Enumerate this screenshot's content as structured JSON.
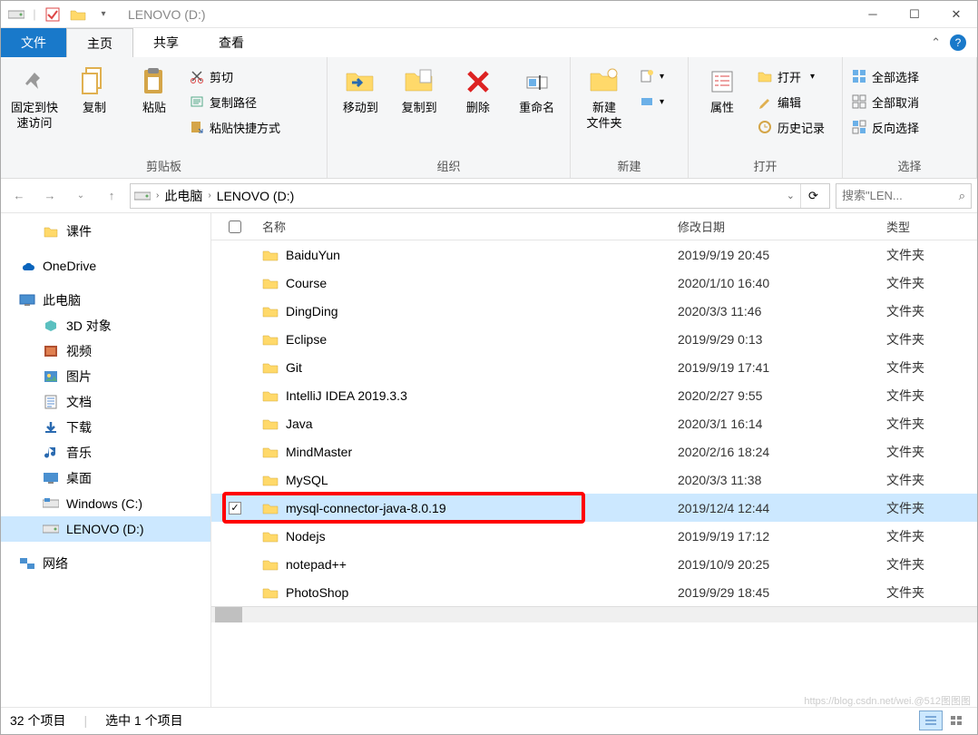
{
  "title": "LENOVO (D:)",
  "tabs": {
    "file": "文件",
    "home": "主页",
    "share": "共享",
    "view": "查看"
  },
  "ribbon": {
    "pin": "固定到快\n速访问",
    "copy": "复制",
    "paste": "粘贴",
    "cut": "剪切",
    "copypath": "复制路径",
    "pasteshortcut": "粘贴快捷方式",
    "group_clipboard": "剪贴板",
    "moveto": "移动到",
    "copyto": "复制到",
    "delete": "删除",
    "rename": "重命名",
    "group_organize": "组织",
    "newfolder": "新建\n文件夹",
    "group_new": "新建",
    "properties": "属性",
    "open": "打开",
    "edit": "编辑",
    "history": "历史记录",
    "group_open": "打开",
    "selectall": "全部选择",
    "selectnone": "全部取消",
    "selectinvert": "反向选择",
    "group_select": "选择"
  },
  "breadcrumb": {
    "pc": "此电脑",
    "drive": "LENOVO (D:)"
  },
  "search_placeholder": "搜索\"LEN...",
  "columns": {
    "name": "名称",
    "date": "修改日期",
    "type": "类型"
  },
  "sidebar": {
    "courseware": "课件",
    "onedrive": "OneDrive",
    "thispc": "此电脑",
    "3d": "3D 对象",
    "video": "视频",
    "pictures": "图片",
    "documents": "文档",
    "downloads": "下载",
    "music": "音乐",
    "desktop": "桌面",
    "cdrive": "Windows (C:)",
    "ddrive": "LENOVO (D:)",
    "network": "网络"
  },
  "files": [
    {
      "name": "BaiduYun",
      "date": "2019/9/19 20:45",
      "type": "文件夹",
      "selected": false
    },
    {
      "name": "Course",
      "date": "2020/1/10 16:40",
      "type": "文件夹",
      "selected": false
    },
    {
      "name": "DingDing",
      "date": "2020/3/3 11:46",
      "type": "文件夹",
      "selected": false
    },
    {
      "name": "Eclipse",
      "date": "2019/9/29 0:13",
      "type": "文件夹",
      "selected": false
    },
    {
      "name": "Git",
      "date": "2019/9/19 17:41",
      "type": "文件夹",
      "selected": false
    },
    {
      "name": "IntelliJ IDEA 2019.3.3",
      "date": "2020/2/27 9:55",
      "type": "文件夹",
      "selected": false
    },
    {
      "name": "Java",
      "date": "2020/3/1 16:14",
      "type": "文件夹",
      "selected": false
    },
    {
      "name": "MindMaster",
      "date": "2020/2/16 18:24",
      "type": "文件夹",
      "selected": false
    },
    {
      "name": "MySQL",
      "date": "2020/3/3 11:38",
      "type": "文件夹",
      "selected": false
    },
    {
      "name": "mysql-connector-java-8.0.19",
      "date": "2019/12/4 12:44",
      "type": "文件夹",
      "selected": true
    },
    {
      "name": "Nodejs",
      "date": "2019/9/19 17:12",
      "type": "文件夹",
      "selected": false
    },
    {
      "name": "notepad++",
      "date": "2019/10/9 20:25",
      "type": "文件夹",
      "selected": false
    },
    {
      "name": "PhotoShop",
      "date": "2019/9/29 18:45",
      "type": "文件夹",
      "selected": false
    }
  ],
  "status": {
    "items": "32 个项目",
    "selected": "选中 1 个项目"
  },
  "watermark": "https://blog.csdn.net/wei.@512图图图"
}
